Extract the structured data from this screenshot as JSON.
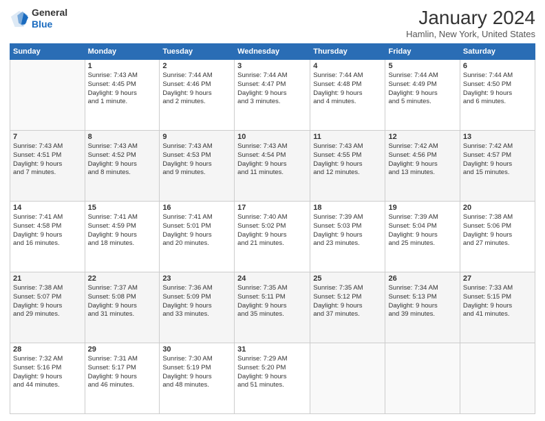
{
  "header": {
    "logo_general": "General",
    "logo_blue": "Blue",
    "month_title": "January 2024",
    "location": "Hamlin, New York, United States"
  },
  "weekdays": [
    "Sunday",
    "Monday",
    "Tuesday",
    "Wednesday",
    "Thursday",
    "Friday",
    "Saturday"
  ],
  "weeks": [
    [
      {
        "day": "",
        "info": ""
      },
      {
        "day": "1",
        "info": "Sunrise: 7:43 AM\nSunset: 4:45 PM\nDaylight: 9 hours\nand 1 minute."
      },
      {
        "day": "2",
        "info": "Sunrise: 7:44 AM\nSunset: 4:46 PM\nDaylight: 9 hours\nand 2 minutes."
      },
      {
        "day": "3",
        "info": "Sunrise: 7:44 AM\nSunset: 4:47 PM\nDaylight: 9 hours\nand 3 minutes."
      },
      {
        "day": "4",
        "info": "Sunrise: 7:44 AM\nSunset: 4:48 PM\nDaylight: 9 hours\nand 4 minutes."
      },
      {
        "day": "5",
        "info": "Sunrise: 7:44 AM\nSunset: 4:49 PM\nDaylight: 9 hours\nand 5 minutes."
      },
      {
        "day": "6",
        "info": "Sunrise: 7:44 AM\nSunset: 4:50 PM\nDaylight: 9 hours\nand 6 minutes."
      }
    ],
    [
      {
        "day": "7",
        "info": "Sunrise: 7:43 AM\nSunset: 4:51 PM\nDaylight: 9 hours\nand 7 minutes."
      },
      {
        "day": "8",
        "info": "Sunrise: 7:43 AM\nSunset: 4:52 PM\nDaylight: 9 hours\nand 8 minutes."
      },
      {
        "day": "9",
        "info": "Sunrise: 7:43 AM\nSunset: 4:53 PM\nDaylight: 9 hours\nand 9 minutes."
      },
      {
        "day": "10",
        "info": "Sunrise: 7:43 AM\nSunset: 4:54 PM\nDaylight: 9 hours\nand 11 minutes."
      },
      {
        "day": "11",
        "info": "Sunrise: 7:43 AM\nSunset: 4:55 PM\nDaylight: 9 hours\nand 12 minutes."
      },
      {
        "day": "12",
        "info": "Sunrise: 7:42 AM\nSunset: 4:56 PM\nDaylight: 9 hours\nand 13 minutes."
      },
      {
        "day": "13",
        "info": "Sunrise: 7:42 AM\nSunset: 4:57 PM\nDaylight: 9 hours\nand 15 minutes."
      }
    ],
    [
      {
        "day": "14",
        "info": "Sunrise: 7:41 AM\nSunset: 4:58 PM\nDaylight: 9 hours\nand 16 minutes."
      },
      {
        "day": "15",
        "info": "Sunrise: 7:41 AM\nSunset: 4:59 PM\nDaylight: 9 hours\nand 18 minutes."
      },
      {
        "day": "16",
        "info": "Sunrise: 7:41 AM\nSunset: 5:01 PM\nDaylight: 9 hours\nand 20 minutes."
      },
      {
        "day": "17",
        "info": "Sunrise: 7:40 AM\nSunset: 5:02 PM\nDaylight: 9 hours\nand 21 minutes."
      },
      {
        "day": "18",
        "info": "Sunrise: 7:39 AM\nSunset: 5:03 PM\nDaylight: 9 hours\nand 23 minutes."
      },
      {
        "day": "19",
        "info": "Sunrise: 7:39 AM\nSunset: 5:04 PM\nDaylight: 9 hours\nand 25 minutes."
      },
      {
        "day": "20",
        "info": "Sunrise: 7:38 AM\nSunset: 5:06 PM\nDaylight: 9 hours\nand 27 minutes."
      }
    ],
    [
      {
        "day": "21",
        "info": "Sunrise: 7:38 AM\nSunset: 5:07 PM\nDaylight: 9 hours\nand 29 minutes."
      },
      {
        "day": "22",
        "info": "Sunrise: 7:37 AM\nSunset: 5:08 PM\nDaylight: 9 hours\nand 31 minutes."
      },
      {
        "day": "23",
        "info": "Sunrise: 7:36 AM\nSunset: 5:09 PM\nDaylight: 9 hours\nand 33 minutes."
      },
      {
        "day": "24",
        "info": "Sunrise: 7:35 AM\nSunset: 5:11 PM\nDaylight: 9 hours\nand 35 minutes."
      },
      {
        "day": "25",
        "info": "Sunrise: 7:35 AM\nSunset: 5:12 PM\nDaylight: 9 hours\nand 37 minutes."
      },
      {
        "day": "26",
        "info": "Sunrise: 7:34 AM\nSunset: 5:13 PM\nDaylight: 9 hours\nand 39 minutes."
      },
      {
        "day": "27",
        "info": "Sunrise: 7:33 AM\nSunset: 5:15 PM\nDaylight: 9 hours\nand 41 minutes."
      }
    ],
    [
      {
        "day": "28",
        "info": "Sunrise: 7:32 AM\nSunset: 5:16 PM\nDaylight: 9 hours\nand 44 minutes."
      },
      {
        "day": "29",
        "info": "Sunrise: 7:31 AM\nSunset: 5:17 PM\nDaylight: 9 hours\nand 46 minutes."
      },
      {
        "day": "30",
        "info": "Sunrise: 7:30 AM\nSunset: 5:19 PM\nDaylight: 9 hours\nand 48 minutes."
      },
      {
        "day": "31",
        "info": "Sunrise: 7:29 AM\nSunset: 5:20 PM\nDaylight: 9 hours\nand 51 minutes."
      },
      {
        "day": "",
        "info": ""
      },
      {
        "day": "",
        "info": ""
      },
      {
        "day": "",
        "info": ""
      }
    ]
  ]
}
